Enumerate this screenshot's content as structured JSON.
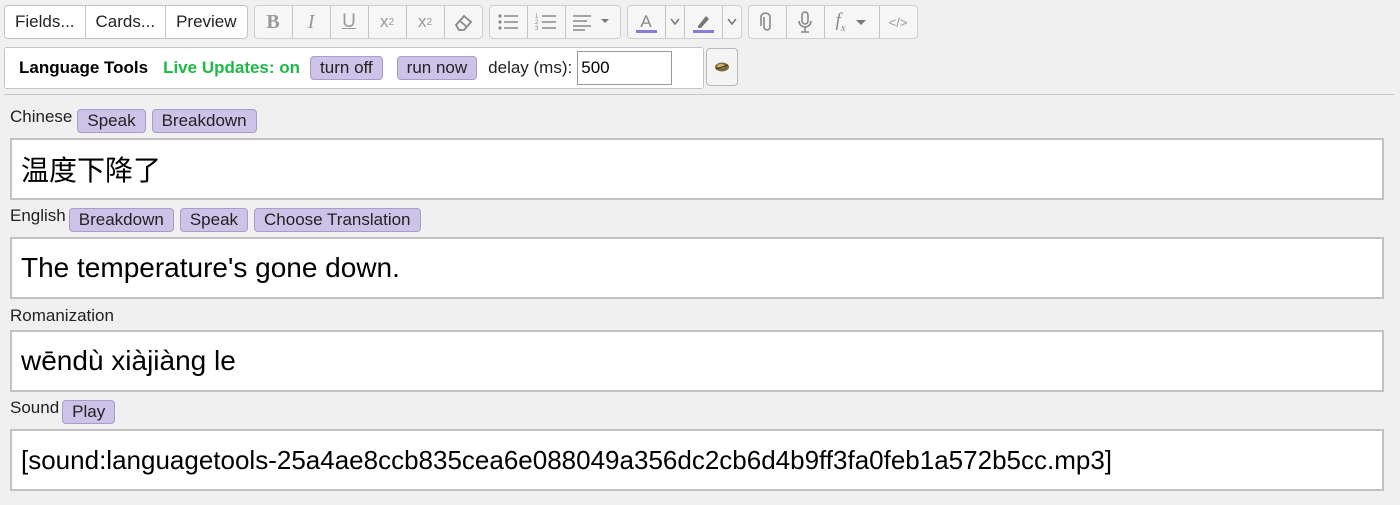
{
  "toolbar": {
    "fields_label": "Fields...",
    "cards_label": "Cards...",
    "preview_label": "Preview",
    "icons": [
      "bold-icon",
      "italic-icon",
      "underline-icon",
      "superscript-icon",
      "subscript-icon",
      "eraser-icon",
      "bullet-list-icon",
      "numbered-list-icon",
      "align-icon",
      "text-color-icon",
      "highlight-icon",
      "attachment-icon",
      "microphone-icon",
      "formula-icon",
      "html-editor-icon"
    ],
    "accent_color": "#8a7bd8"
  },
  "language_tools": {
    "title": "Language Tools",
    "live_updates": "Live Updates: on",
    "live_color": "#20b847",
    "turn_off_label": "turn off",
    "run_now_label": "run now",
    "delay_label": "delay (ms):",
    "delay_value": "500"
  },
  "fields": [
    {
      "name": "Chinese",
      "buttons": [
        "Speak",
        "Breakdown"
      ],
      "value": "温度下降了"
    },
    {
      "name": "English",
      "buttons": [
        "Breakdown",
        "Speak",
        "Choose Translation"
      ],
      "value": "The temperature's gone down."
    },
    {
      "name": "Romanization",
      "buttons": [],
      "value": "wēndù xiàjiàng le"
    },
    {
      "name": "Sound",
      "buttons": [
        "Play"
      ],
      "value": "[sound:languagetools-25a4ae8ccb835cea6e088049a356dc2cb6d4b9ff3fa0feb1a572b5cc.mp3]"
    }
  ]
}
